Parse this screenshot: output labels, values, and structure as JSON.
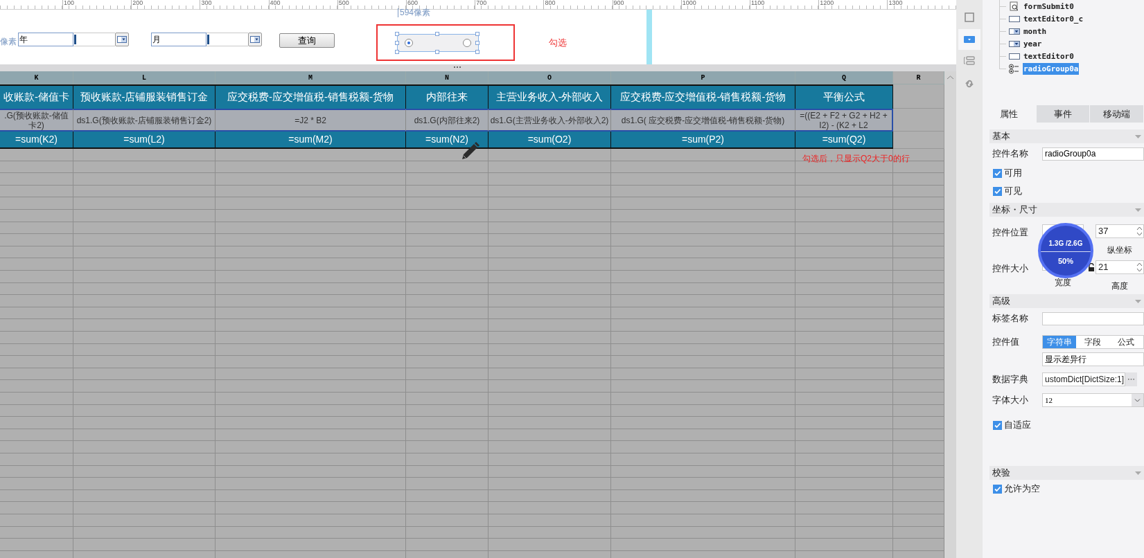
{
  "ruler": {
    "labels": [
      "100",
      "200",
      "300",
      "400",
      "500",
      "600",
      "700",
      "800",
      "900",
      "1000",
      "1100",
      "1200",
      "1300"
    ]
  },
  "form": {
    "edge_label": "像素",
    "year_field": {
      "value": "年"
    },
    "month_field": {
      "value": "月"
    },
    "query_button": "查询",
    "width_hint": "594像素",
    "radio_group": {
      "options": [
        {
          "selected": true
        },
        {
          "selected": false
        }
      ]
    },
    "note": "勾选"
  },
  "sheet": {
    "columns": [
      "K",
      "L",
      "M",
      "N",
      "O",
      "P",
      "Q",
      "R"
    ],
    "header_row": [
      "收账款-储值卡",
      "预收账款-店铺服装销售订金",
      "应交税费-应交增值税-销售税额-货物",
      "内部往来",
      "主营业务收入-外部收入",
      "应交税费-应交增值税-销售税额-货物",
      "平衡公式"
    ],
    "formula_row": [
      ".G(预收账款-储值卡2)",
      "ds1.G(预收账款-店铺服装销售订金2)",
      "=J2 * B2",
      "ds1.G(内部往来2)",
      "ds1.G(主营业务收入-外部收入2)",
      "ds1.G( 应交税费-应交增值税-销售税额-货物)",
      "=((E2 + F2 + G2 + H2 + I2) - (K2 + L2"
    ],
    "sum_row": [
      "=sum(K2)",
      "=sum(L2)",
      "=sum(M2)",
      "=sum(N2)",
      "=sum(O2)",
      "=sum(P2)",
      "=sum(Q2)"
    ],
    "note": "勾选后，只显示Q2大于0的行"
  },
  "side_tools": [
    {
      "kind": "frame",
      "selected": false
    },
    {
      "kind": "dropdown",
      "selected": true
    },
    {
      "kind": "layout",
      "selected": false
    },
    {
      "kind": "link",
      "selected": false
    }
  ],
  "tree": [
    {
      "label": "formSubmit0",
      "kind": "submit",
      "selected": false
    },
    {
      "label": "textEditor0_c",
      "kind": "text",
      "selected": false
    },
    {
      "label": "month",
      "kind": "combo",
      "selected": false
    },
    {
      "label": "year",
      "kind": "combo",
      "selected": false
    },
    {
      "label": "textEditor0",
      "kind": "text",
      "selected": false
    },
    {
      "label": "radioGroup0a",
      "kind": "radio",
      "selected": true
    }
  ],
  "tabs": [
    {
      "label": "属性",
      "selected": true
    },
    {
      "label": "事件",
      "selected": false
    },
    {
      "label": "移动端",
      "selected": false
    }
  ],
  "sections": [
    {
      "title": "基本",
      "rows": [
        {
          "kind": "text",
          "label": "控件名称",
          "value": "radioGroup0a"
        },
        {
          "kind": "check",
          "label": "可用",
          "checked": true
        },
        {
          "kind": "check",
          "label": "可见",
          "checked": true
        }
      ]
    },
    {
      "title": "坐标・尺寸",
      "rows": [
        {
          "kind": "pair",
          "label": "控件位置",
          "value": "37",
          "caption": "纵坐标",
          "locked": false
        },
        {
          "kind": "pair",
          "label": "控件大小",
          "value": "21",
          "left_caption": "宽度",
          "caption": "高度",
          "locked": true
        }
      ]
    },
    {
      "title": "高级",
      "rows": [
        {
          "kind": "text",
          "label": "标签名称"
        },
        {
          "kind": "segmented",
          "label": "控件值",
          "options": [
            {
              "label": "字符串",
              "selected": true
            },
            {
              "label": "字段",
              "selected": false
            },
            {
              "label": "公式",
              "selected": false
            }
          ],
          "value": "显示差异行"
        },
        {
          "kind": "dict",
          "label": "数据字典",
          "value": "ustomDict[DictSize:1]"
        },
        {
          "kind": "select",
          "label": "字体大小",
          "value": "12"
        },
        {
          "kind": "check",
          "label": "自适应",
          "checked": true
        }
      ]
    },
    {
      "title": "校验",
      "rows": [
        {
          "kind": "check",
          "label": "允许为空",
          "checked": true
        }
      ]
    }
  ],
  "memory_widget": {
    "usage": "1.3G /2.6G",
    "percent": "50%"
  }
}
